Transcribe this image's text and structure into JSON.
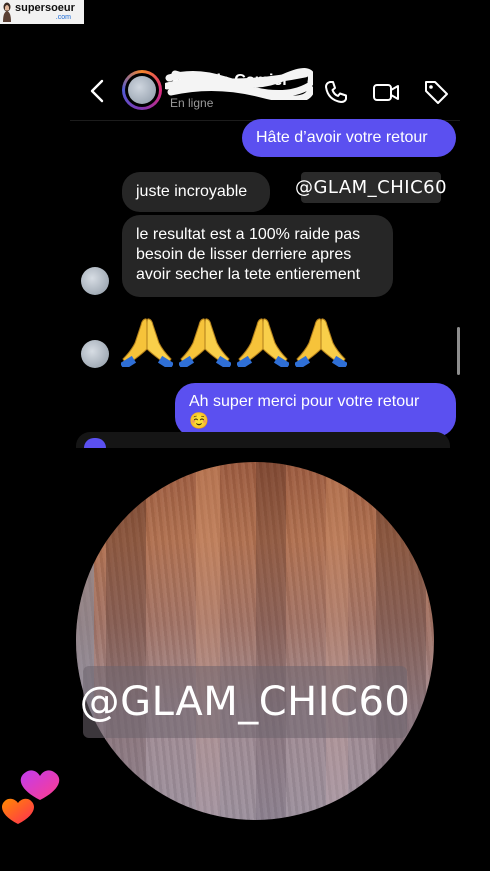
{
  "watermark": {
    "name": "supersoeur",
    "domain": ".com"
  },
  "header": {
    "contact_name": "Patricia Camier",
    "status": "En ligne",
    "icons": [
      "back-chevron-icon",
      "phone-icon",
      "video-camera-icon",
      "tag-icon"
    ]
  },
  "messages": [
    {
      "direction": "sent",
      "text": "Hâte d’avoir votre retour"
    },
    {
      "direction": "received",
      "text": "juste incroyable"
    },
    {
      "direction": "received",
      "text": "le resultat est a 100% raide pas besoin de lisser derriere apres avoir secher la tete entierement"
    },
    {
      "direction": "received",
      "text": "🙏🙏🙏🙏",
      "emoji": "folded-hands",
      "count": 4
    },
    {
      "direction": "sent",
      "text": "Ah super merci pour votre retour ☺️"
    }
  ],
  "stickers": {
    "handle_top": "@GLAM_CHIC60",
    "handle_photo": "@GLAM_CHIC60"
  },
  "colors": {
    "sent_bubble": "#5b50f0",
    "received_bubble": "#262626",
    "background": "#000000"
  }
}
